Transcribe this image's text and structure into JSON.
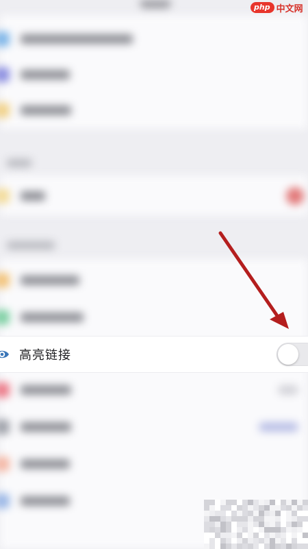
{
  "settings": {
    "highlight_link": {
      "label": "高亮链接",
      "icon": "eye-icon",
      "enabled": false
    }
  },
  "watermark": {
    "badge": "php",
    "text": "中文网"
  },
  "colors": {
    "background": "#eeeef2",
    "row_background": "#ffffff",
    "text": "#1f1f22",
    "eye_icon": "#3a76b8",
    "toggle_off": "#e9e9ec",
    "arrow": "#b41e1e",
    "watermark_red": "#e8352c"
  }
}
